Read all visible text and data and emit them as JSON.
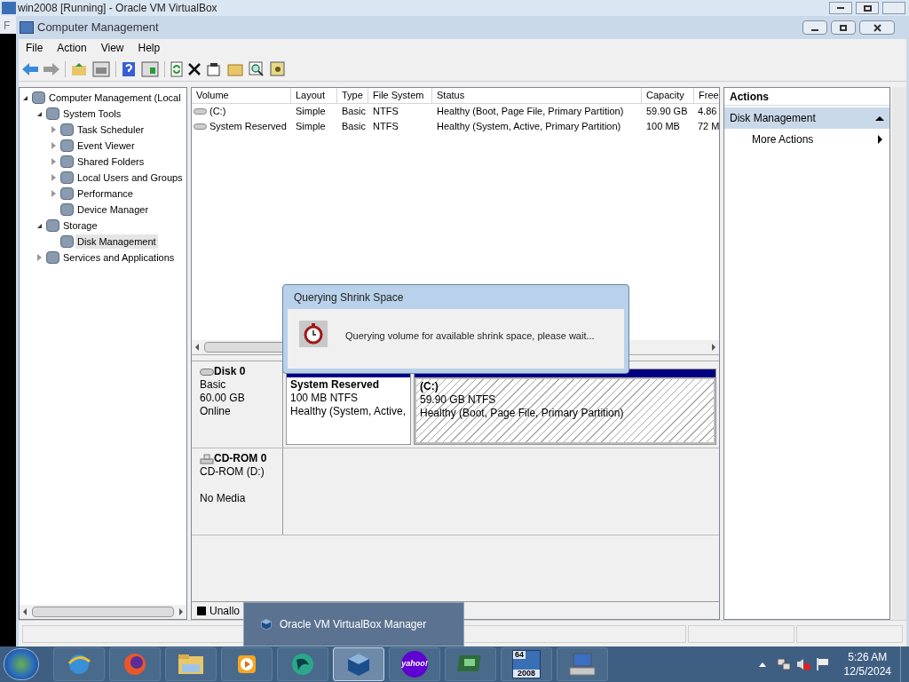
{
  "host_window": {
    "title": "win2008 [Running] - Oracle VM VirtualBox",
    "menu_fragment": "F"
  },
  "window": {
    "title": "Computer Management"
  },
  "menu": [
    "File",
    "Action",
    "View",
    "Help"
  ],
  "tree": [
    {
      "label": "Computer Management (Local",
      "selected": false,
      "expanded": true,
      "children": [
        {
          "label": "System Tools",
          "selected": false,
          "expanded": true,
          "children": [
            {
              "label": "Task Scheduler",
              "selected": false,
              "expanded": false
            },
            {
              "label": "Event Viewer",
              "selected": false,
              "expanded": false
            },
            {
              "label": "Shared Folders",
              "selected": false,
              "expanded": false
            },
            {
              "label": "Local Users and Groups",
              "selected": false,
              "expanded": false
            },
            {
              "label": "Performance",
              "selected": false,
              "expanded": false
            },
            {
              "label": "Device Manager",
              "selected": false
            }
          ]
        },
        {
          "label": "Storage",
          "selected": false,
          "expanded": true,
          "children": [
            {
              "label": "Disk Management",
              "selected": true
            }
          ]
        },
        {
          "label": "Services and Applications",
          "selected": false,
          "expanded": false
        }
      ]
    }
  ],
  "table": {
    "columns": [
      "Volume",
      "Layout",
      "Type",
      "File System",
      "Status",
      "Capacity",
      "Free"
    ],
    "rows": [
      [
        "(C:)",
        "Simple",
        "Basic",
        "NTFS",
        "Healthy (Boot, Page File, Primary Partition)",
        "59.90 GB",
        "4.86"
      ],
      [
        "System Reserved",
        "Simple",
        "Basic",
        "NTFS",
        "Healthy (System, Active, Primary Partition)",
        "100 MB",
        "72 M"
      ]
    ]
  },
  "disks": [
    {
      "kind": "disk",
      "name": "Disk 0",
      "lines": [
        "Basic",
        "60.00 GB",
        "Online"
      ],
      "partitions": [
        {
          "name": "System Reserved",
          "size": "100 MB NTFS",
          "status": "Healthy (System, Active,",
          "selected": false
        },
        {
          "name": "(C:)",
          "size": "59.90 GB NTFS",
          "status": "Healthy (Boot, Page File, Primary Partition)",
          "selected": true
        }
      ]
    },
    {
      "kind": "cdrom",
      "name": "CD-ROM 0",
      "lines": [
        "CD-ROM (D:)",
        "No Media"
      ]
    }
  ],
  "legend": [
    "Unallo"
  ],
  "actions": {
    "title": "Actions",
    "section": "Disk Management",
    "items": [
      "More Actions"
    ]
  },
  "dialog": {
    "title": "Querying Shrink Space",
    "message": "Querying volume for available shrink space, please wait..."
  },
  "taskbar_popup": {
    "label": "Oracle VM VirtualBox Manager"
  },
  "taskbar": [
    {
      "kind": "ie",
      "selected": false
    },
    {
      "kind": "firefox",
      "selected": false
    },
    {
      "kind": "explorer",
      "selected": false
    },
    {
      "kind": "media",
      "selected": false
    },
    {
      "kind": "app",
      "selected": false
    },
    {
      "kind": "virtualbox",
      "selected": true
    },
    {
      "kind": "yahoo",
      "text": "yahoo!",
      "selected": false
    },
    {
      "kind": "monitor",
      "selected": false
    },
    {
      "kind": "server",
      "text": [
        "64",
        "2008"
      ],
      "selected": false
    },
    {
      "kind": "remote",
      "selected": false
    }
  ],
  "clock": {
    "time": "5:26 AM",
    "date": "12/5/2024"
  }
}
